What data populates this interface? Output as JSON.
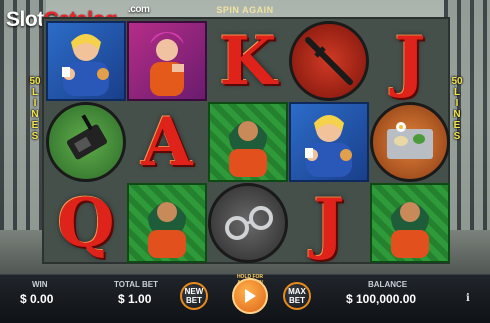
{
  "logo": {
    "part1": "Slot",
    "part2": "Catalog",
    "suffix": ".com"
  },
  "header": {
    "spin_again": "SPIN AGAIN"
  },
  "lines_label": "50 LINES",
  "reels": {
    "columns": [
      [
        {
          "symbol": "guard-woman-icon"
        },
        {
          "symbol": "radio-icon"
        },
        {
          "symbol": "Q"
        }
      ],
      [
        {
          "symbol": "punk-woman-icon"
        },
        {
          "symbol": "A"
        },
        {
          "symbol": "inmate-woman-icon"
        }
      ],
      [
        {
          "symbol": "K"
        },
        {
          "symbol": "inmate-woman-icon"
        },
        {
          "symbol": "handcuffs-icon"
        }
      ],
      [
        {
          "symbol": "baton-icon"
        },
        {
          "symbol": "guard-woman-icon"
        },
        {
          "symbol": "J"
        }
      ],
      [
        {
          "symbol": "J"
        },
        {
          "symbol": "food-tray-icon"
        },
        {
          "symbol": "inmate-woman-icon"
        }
      ]
    ]
  },
  "bottom_bar": {
    "win_label": "WIN",
    "win_value": "$ 0.00",
    "total_bet_label": "TOTAL BET",
    "total_bet_value": "$ 1.00",
    "new_bet_label": "NEW BET",
    "hold_label": "HOLD FOR AUTOSPIN",
    "max_bet_label": "MAX BET",
    "balance_label": "BALANCE",
    "balance_value": "$ 100,000.00",
    "info_label": "i"
  },
  "colors": {
    "accent": "#e98a1c",
    "lines_text": "#f3e44a",
    "letter": "#e0231a"
  }
}
